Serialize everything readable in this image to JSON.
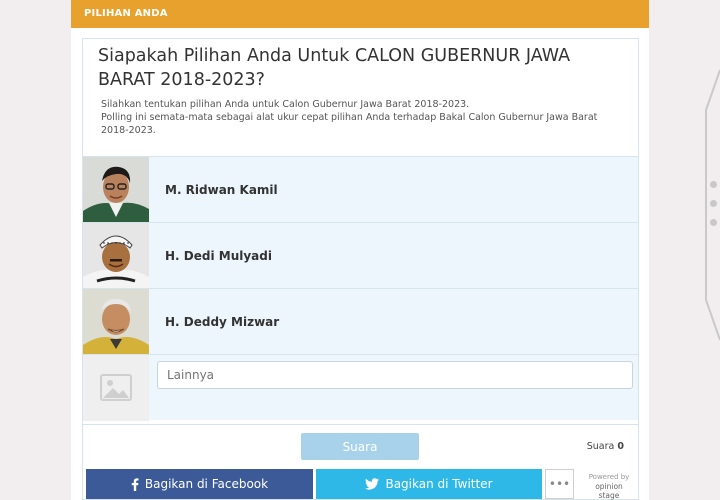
{
  "header": {
    "label": "PILIHAN ANDA"
  },
  "poll": {
    "title": "Siapakah Pilihan Anda Untuk CALON GUBERNUR JAWA BARAT 2018-2023?",
    "subtitle_lines": [
      "Silahkan tentukan pilihan Anda untuk Calon Gubernur Jawa Barat 2018-2023.",
      "Polling ini semata-mata sebagai alat ukur cepat pilihan Anda terhadap Bakal Calon Gubernur Jawa Barat 2018-2023."
    ],
    "options": [
      {
        "name": "M. Ridwan Kamil"
      },
      {
        "name": "H. Dedi Mulyadi"
      },
      {
        "name": "H. Deddy Mizwar"
      }
    ],
    "other_placeholder": "Lainnya",
    "vote_label": "Suara",
    "votes_label": "Suara",
    "votes_count": "0"
  },
  "share": {
    "facebook_label": "Bagikan di Facebook",
    "twitter_label": "Bagikan di Twitter",
    "more_label": "•••",
    "powered_line1": "Powered by",
    "powered_line2": "opinion stage"
  },
  "colors": {
    "header": "#e8a12c",
    "option_bg": "#eef6fd",
    "vote_button": "#a8d2ea",
    "facebook": "#3c5a98",
    "twitter": "#2eb8e8"
  },
  "icons": {
    "facebook": "facebook-icon",
    "twitter": "twitter-icon",
    "image_placeholder": "image-placeholder-icon"
  }
}
